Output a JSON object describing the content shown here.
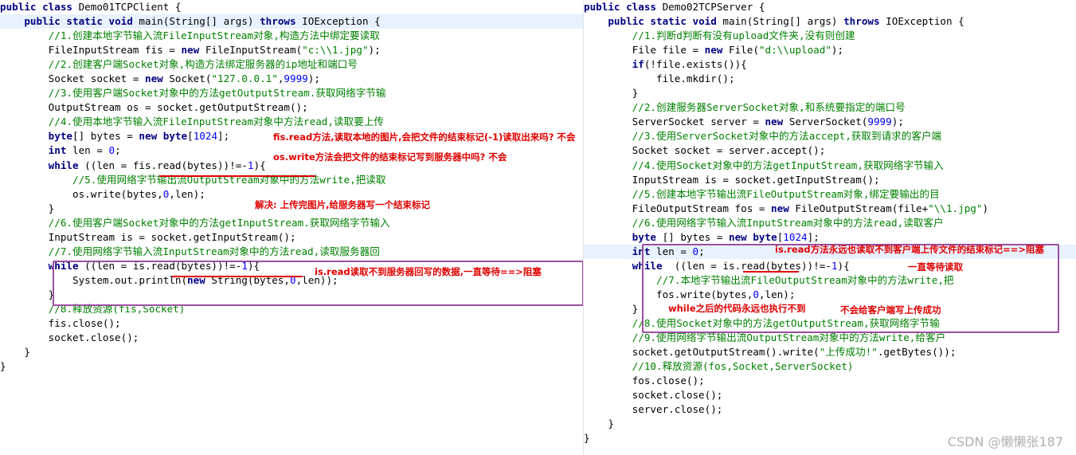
{
  "left": {
    "lines": [
      [
        [
          "kw",
          "public "
        ],
        [
          "kw",
          "class "
        ],
        [
          "t",
          "Demo01TCPClient {"
        ]
      ],
      [
        [
          "t",
          "    "
        ],
        [
          "kw",
          "public "
        ],
        [
          "kw",
          "static "
        ],
        [
          "kw",
          "void "
        ],
        [
          "t",
          "main(String[] args) "
        ],
        [
          "kw",
          "throws "
        ],
        [
          "t",
          "IOException {"
        ]
      ],
      [
        [
          "t",
          "        "
        ],
        [
          "cm",
          "//1.创建本地字节输入流FileInputStream对象,构造方法中绑定要读取"
        ]
      ],
      [
        [
          "t",
          "        FileInputStream fis = "
        ],
        [
          "kw",
          "new "
        ],
        [
          "t",
          "FileInputStream("
        ],
        [
          "str",
          "\"c:\\\\1.jpg\""
        ],
        [
          "t",
          ");"
        ]
      ],
      [
        [
          "t",
          "        "
        ],
        [
          "cm",
          "//2.创建客户端Socket对象,构造方法绑定服务器的ip地址和端口号"
        ]
      ],
      [
        [
          "t",
          "        Socket socket = "
        ],
        [
          "kw",
          "new "
        ],
        [
          "t",
          "Socket("
        ],
        [
          "str",
          "\"127.0.0.1\""
        ],
        [
          "t",
          ","
        ],
        [
          "num",
          "9999"
        ],
        [
          "t",
          ");"
        ]
      ],
      [
        [
          "t",
          "        "
        ],
        [
          "cm",
          "//3.使用客户端Socket对象中的方法getOutputStream.获取网络字节输"
        ]
      ],
      [
        [
          "t",
          "        OutputStream os = socket.getOutputStream();"
        ]
      ],
      [
        [
          "t",
          "        "
        ],
        [
          "cm",
          "//4.使用本地字节输入流FileInputStream对象中方法read,读取要上传"
        ]
      ],
      [
        [
          "t",
          "        "
        ],
        [
          "kw",
          "byte"
        ],
        [
          "t",
          "[] bytes = "
        ],
        [
          "kw",
          "new "
        ],
        [
          "kw",
          "byte"
        ],
        [
          "t",
          "["
        ],
        [
          "num",
          "1024"
        ],
        [
          "t",
          "];"
        ]
      ],
      [
        [
          "t",
          "        "
        ],
        [
          "kw",
          "int "
        ],
        [
          "t",
          "len = "
        ],
        [
          "num",
          "0"
        ],
        [
          "t",
          ";"
        ]
      ],
      [
        [
          "t",
          "        "
        ],
        [
          "kw",
          "while "
        ],
        [
          "t",
          "((len = fis.read(bytes))!=-"
        ],
        [
          "num",
          "1"
        ],
        [
          "t",
          "){"
        ]
      ],
      [
        [
          "t",
          "            "
        ],
        [
          "cm",
          "//5.使用网络字节输出流OutputStream对象中的方法write,把读取"
        ]
      ],
      [
        [
          "t",
          "            os.write(bytes,"
        ],
        [
          "num",
          "0"
        ],
        [
          "t",
          ",len);"
        ]
      ],
      [
        [
          "t",
          "        }"
        ]
      ],
      [
        [
          "t",
          "        "
        ],
        [
          "cm",
          "//6.使用客户端Socket对象中的方法getInputStream.获取网络字节输入"
        ]
      ],
      [
        [
          "t",
          "        InputStream is = socket.getInputStream();"
        ]
      ],
      [
        [
          "t",
          "        "
        ],
        [
          "cm",
          "//7.使用网络字节输入流InputStream对象中的方法read,读取服务器回"
        ]
      ],
      [
        [
          "t",
          "        "
        ],
        [
          "kw",
          "while "
        ],
        [
          "t",
          "((len = is.read(bytes))!=-"
        ],
        [
          "num",
          "1"
        ],
        [
          "t",
          "){"
        ]
      ],
      [
        [
          "t",
          "            System.out.println("
        ],
        [
          "kw",
          "new "
        ],
        [
          "t",
          "String(bytes,"
        ],
        [
          "num",
          "0"
        ],
        [
          "t",
          ",len));"
        ]
      ],
      [
        [
          "t",
          "        }"
        ]
      ],
      [
        [
          "t",
          "        "
        ],
        [
          "cm",
          "//8.释放资源(fis,Socket)"
        ]
      ],
      [
        [
          "t",
          "        fis.close();"
        ]
      ],
      [
        [
          "t",
          "        socket.close();"
        ]
      ],
      [
        [
          "t",
          "    }"
        ]
      ],
      [
        [
          "t",
          "}"
        ]
      ]
    ],
    "annotations": {
      "a1": "fis.read方法,读取本地的图片,会把文件的结束标记(-1)读取出来吗? 不会",
      "a2": "os.write方法会把文件的结束标记写到服务器中吗? 不会",
      "a3": "解决: 上传完图片,给服务器写一个结束标记",
      "a4": "is.read读取不到服务器回写的数据,一直等待==>阻塞"
    }
  },
  "right": {
    "lines": [
      [
        [
          "kw",
          "public "
        ],
        [
          "kw",
          "class "
        ],
        [
          "t",
          "Demo02TCPServer {"
        ]
      ],
      [
        [
          "t",
          "    "
        ],
        [
          "kw",
          "public "
        ],
        [
          "kw",
          "static "
        ],
        [
          "kw",
          "void "
        ],
        [
          "t",
          "main(String[] args) "
        ],
        [
          "kw",
          "throws "
        ],
        [
          "t",
          "IOException {"
        ]
      ],
      [
        [
          "t",
          "        "
        ],
        [
          "cm",
          "//1.判断d判断有没有upload文件夹,没有则创建"
        ]
      ],
      [
        [
          "t",
          "        File file = "
        ],
        [
          "kw",
          "new "
        ],
        [
          "t",
          "File("
        ],
        [
          "str",
          "\"d:\\\\upload\""
        ],
        [
          "t",
          ");"
        ]
      ],
      [
        [
          "t",
          "        "
        ],
        [
          "kw",
          "if"
        ],
        [
          "t",
          "(!file.exists()){"
        ]
      ],
      [
        [
          "t",
          "            file.mkdir();"
        ]
      ],
      [
        [
          "t",
          "        }"
        ]
      ],
      [
        [
          "t",
          "        "
        ],
        [
          "cm",
          "//2.创建服务器ServerSocket对象,和系统要指定的端口号"
        ]
      ],
      [
        [
          "t",
          "        ServerSocket server = "
        ],
        [
          "kw",
          "new "
        ],
        [
          "t",
          "ServerSocket("
        ],
        [
          "num",
          "9999"
        ],
        [
          "t",
          ");"
        ]
      ],
      [
        [
          "t",
          "        "
        ],
        [
          "cm",
          "//3.使用ServerSocket对象中的方法accept,获取到请求的客户端"
        ]
      ],
      [
        [
          "t",
          "        Socket socket = server.accept();"
        ]
      ],
      [
        [
          "t",
          "        "
        ],
        [
          "cm",
          "//4.使用Socket对象中的方法getInputStream,获取网络字节输入"
        ]
      ],
      [
        [
          "t",
          "        InputStream is = socket.getInputStream();"
        ]
      ],
      [
        [
          "t",
          "        "
        ],
        [
          "cm",
          "//5.创建本地字节输出流FileOutputStream对象,绑定要输出的目"
        ]
      ],
      [
        [
          "t",
          "        FileOutputStream fos = "
        ],
        [
          "kw",
          "new "
        ],
        [
          "t",
          "FileOutputStream(file+"
        ],
        [
          "str",
          "\"\\\\1.jpg\""
        ],
        [
          "t",
          ")"
        ]
      ],
      [
        [
          "t",
          "        "
        ],
        [
          "cm",
          "//6.使用网络字节输入流InputStream对象中的方法read,读取客户"
        ]
      ],
      [
        [
          "t",
          "        "
        ],
        [
          "kw",
          "byte "
        ],
        [
          "t",
          "[] bytes = "
        ],
        [
          "kw",
          "new "
        ],
        [
          "kw",
          "byte"
        ],
        [
          "t",
          "["
        ],
        [
          "num",
          "1024"
        ],
        [
          "t",
          "];"
        ]
      ],
      [
        [
          "t",
          "        "
        ],
        [
          "kw",
          "int "
        ],
        [
          "t",
          "len = "
        ],
        [
          "num",
          "0"
        ],
        [
          "t",
          ";"
        ]
      ],
      [
        [
          "t",
          "        "
        ],
        [
          "kw",
          "while "
        ],
        [
          "t",
          " ((len = is.read(bytes))!=-"
        ],
        [
          "num",
          "1"
        ],
        [
          "t",
          "){"
        ]
      ],
      [
        [
          "t",
          "            "
        ],
        [
          "cm",
          "//7.本地字节输出流FileOutputStream对象中的方法write,把"
        ]
      ],
      [
        [
          "t",
          "            fos.write(bytes,"
        ],
        [
          "num",
          "0"
        ],
        [
          "t",
          ",len);"
        ]
      ],
      [
        [
          "t",
          "        }"
        ]
      ],
      [
        [
          "t",
          "        "
        ],
        [
          "cm",
          "//8.使用Socket对象中的方法getOutputStream,获取网络字节输"
        ]
      ],
      [
        [
          "t",
          "        "
        ],
        [
          "cm",
          "//9.使用网络字节输出流OutputStream对象中的方法write,给客户"
        ]
      ],
      [
        [
          "t",
          "        socket.getOutputStream().write("
        ],
        [
          "str",
          "\"上传成功!\""
        ],
        [
          "t",
          ".getBytes());"
        ]
      ],
      [
        [
          "t",
          "        "
        ],
        [
          "cm",
          "//10.释放资源(fos,Socket,ServerSocket)"
        ]
      ],
      [
        [
          "t",
          "        fos.close();"
        ]
      ],
      [
        [
          "t",
          "        socket.close();"
        ]
      ],
      [
        [
          "t",
          "        server.close();"
        ]
      ],
      [
        [
          "t",
          "    }"
        ]
      ],
      [
        [
          "t",
          "}"
        ]
      ]
    ],
    "annotations": {
      "b1": "is.read方法永远也读取不到客户端上传文件的结束标记==>阻塞",
      "b2": "一直等待读取",
      "b3": "while之后的代码永远也执行不到",
      "b4": "不会给客户端写上传成功"
    }
  },
  "watermark": "CSDN @懒懒张187",
  "colors": {
    "keyword": "#000080",
    "comment": "#008000",
    "number": "#0000ff",
    "annotation": "#e00000",
    "box": "#9b4fa0"
  }
}
